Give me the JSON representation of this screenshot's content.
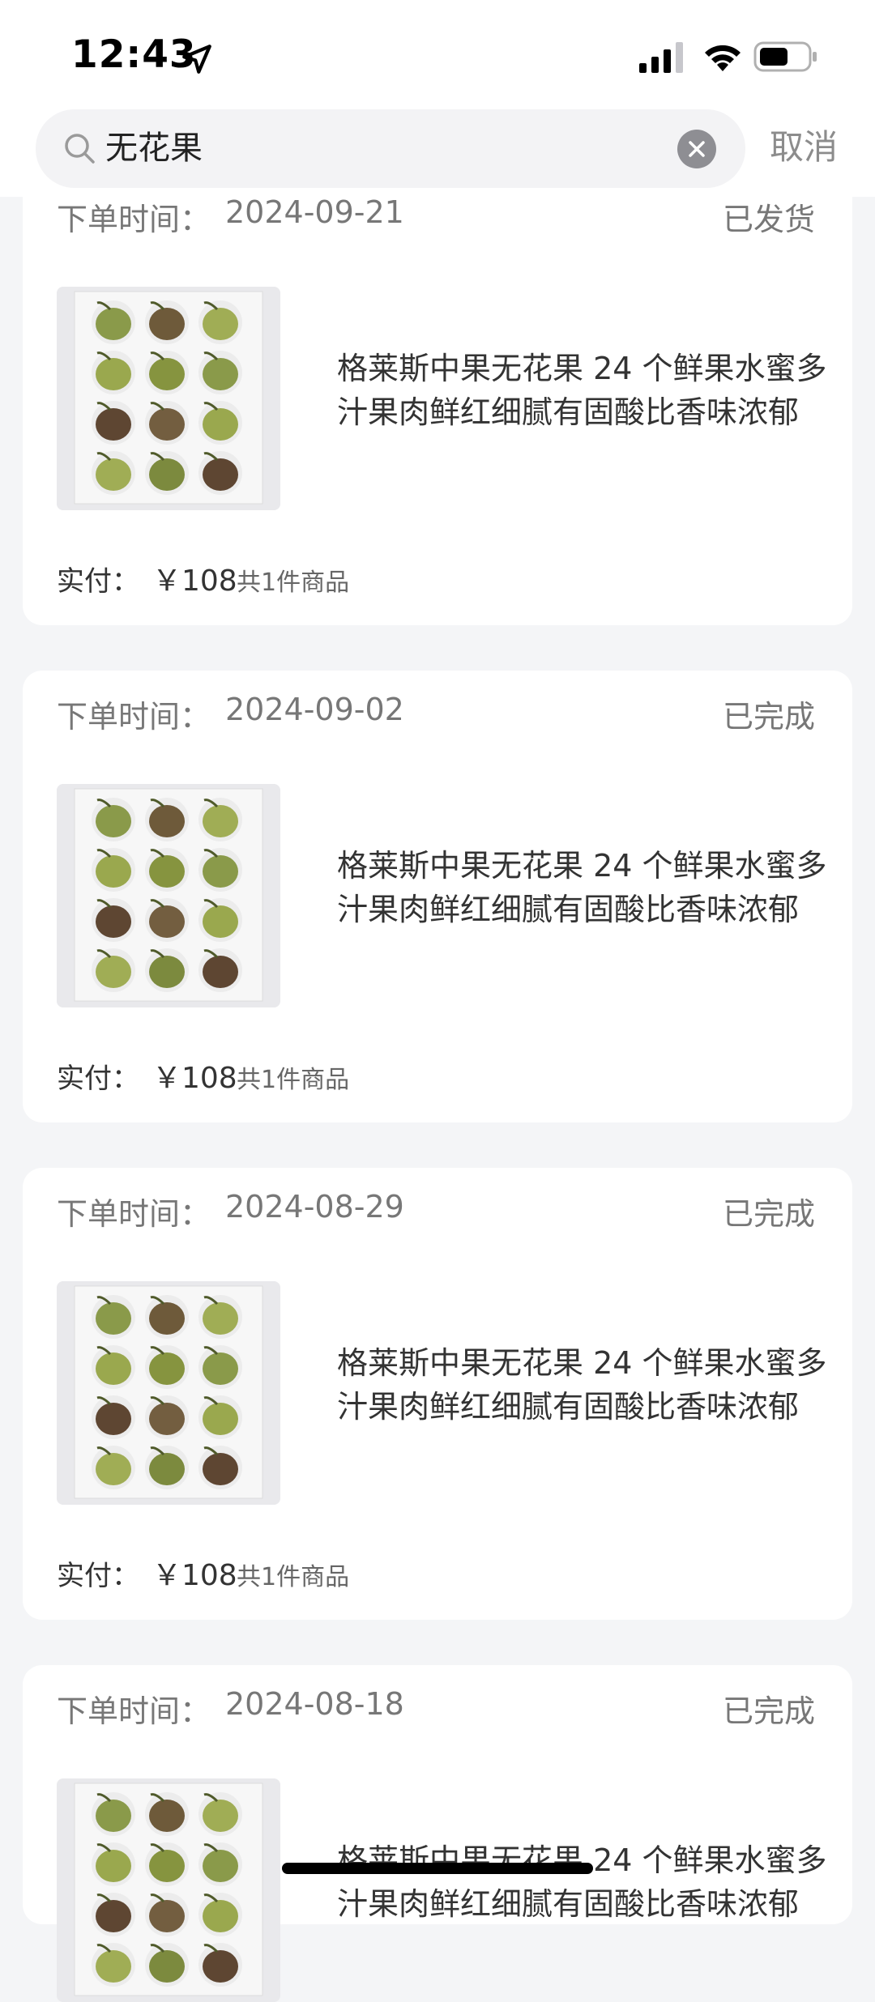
{
  "status_bar": {
    "time": "12:43",
    "icons": [
      "location-arrow-icon",
      "cellular-signal-icon",
      "wifi-icon",
      "battery-icon"
    ]
  },
  "search": {
    "query": "无花果",
    "cancel_label": "取消"
  },
  "orders": [
    {
      "time_label": "下单时间：",
      "date": "2024-09-21",
      "status": "已发货",
      "product_title": "格莱斯中果无花果 24 个鲜果水蜜多汁果肉鲜红细腻有固酸比香味浓郁",
      "paid_label": "实付：",
      "paid_amount": "￥108",
      "item_count": "共1件商品"
    },
    {
      "time_label": "下单时间：",
      "date": "2024-09-02",
      "status": "已完成",
      "product_title": "格莱斯中果无花果 24 个鲜果水蜜多汁果肉鲜红细腻有固酸比香味浓郁",
      "paid_label": "实付：",
      "paid_amount": "￥108",
      "item_count": "共1件商品"
    },
    {
      "time_label": "下单时间：",
      "date": "2024-08-29",
      "status": "已完成",
      "product_title": "格莱斯中果无花果 24 个鲜果水蜜多汁果肉鲜红细腻有固酸比香味浓郁",
      "paid_label": "实付：",
      "paid_amount": "￥108",
      "item_count": "共1件商品"
    },
    {
      "time_label": "下单时间：",
      "date": "2024-08-18",
      "status": "已完成",
      "product_title": "格莱斯中果无花果 24 个鲜果水蜜多汁果肉鲜红细腻有固酸比香味浓郁"
    }
  ]
}
